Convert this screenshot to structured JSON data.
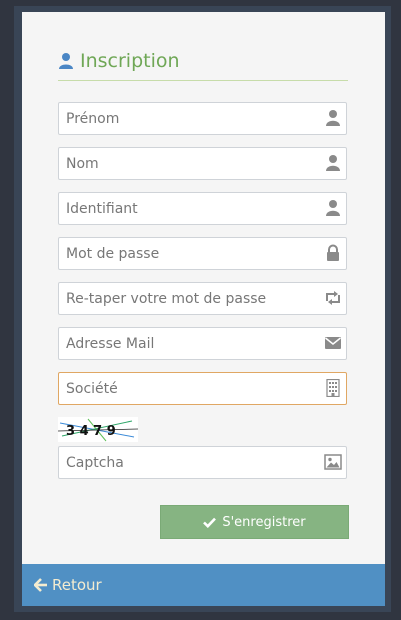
{
  "form": {
    "title": "Inscription",
    "fields": [
      {
        "placeholder": "Prénom",
        "icon": "user-icon"
      },
      {
        "placeholder": "Nom",
        "icon": "user-icon"
      },
      {
        "placeholder": "Identifiant",
        "icon": "user-icon"
      },
      {
        "placeholder": "Mot de passe",
        "icon": "lock-icon"
      },
      {
        "placeholder": "Re-taper votre mot de passe",
        "icon": "retweet-icon"
      },
      {
        "placeholder": "Adresse Mail",
        "icon": "envelope-icon"
      },
      {
        "placeholder": "Société",
        "icon": "building-icon"
      }
    ],
    "captcha_text": "3 4 7 9",
    "captcha_field": {
      "placeholder": "Captcha",
      "icon": "image-icon"
    },
    "submit_label": "S'enregistrer"
  },
  "footer": {
    "back_label": "Retour"
  },
  "colors": {
    "accent_title": "#6fa756",
    "submit_bg": "#86b482",
    "footer_bg": "#5090c4",
    "active_border": "#e0a763"
  }
}
